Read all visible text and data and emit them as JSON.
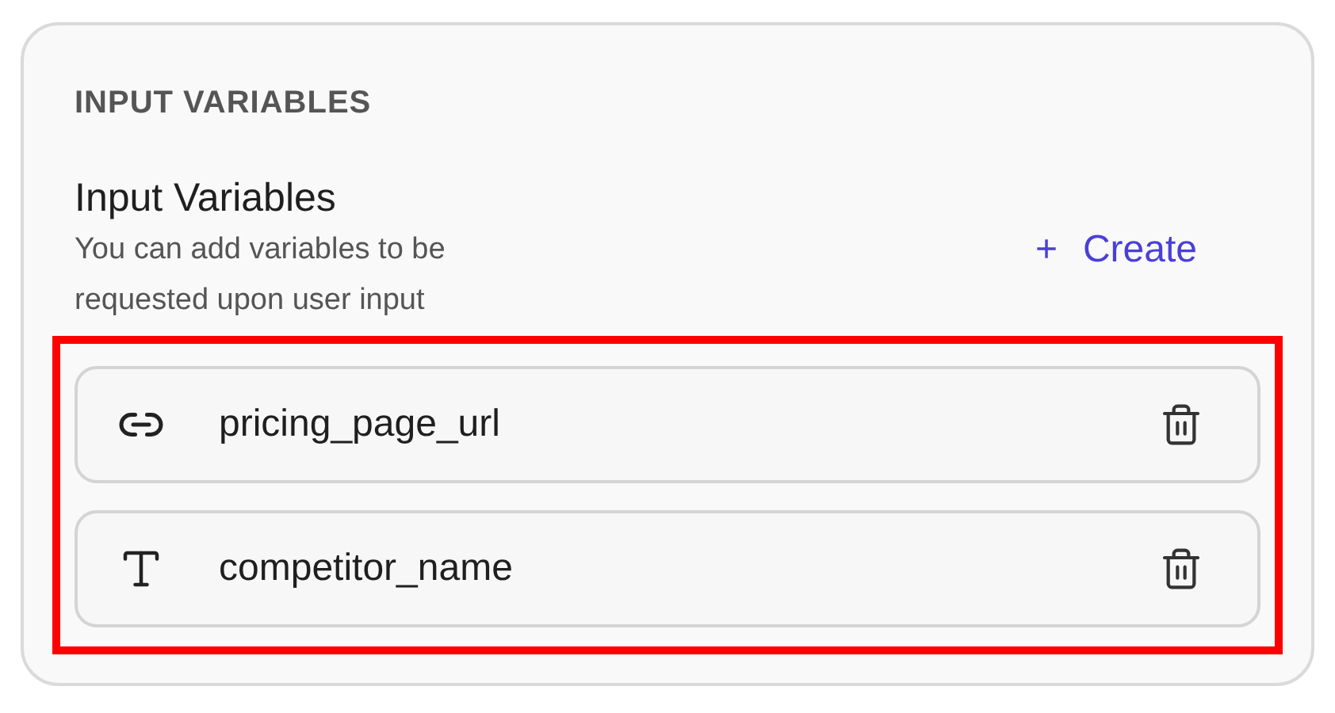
{
  "section_label": "INPUT VARIABLES",
  "header": {
    "title": "Input Variables",
    "description": "You can add variables to be requested upon user input",
    "create_button": {
      "icon": "+",
      "label": "Create"
    }
  },
  "variables_highlighted": true,
  "variables": [
    {
      "kind": "link",
      "name": "pricing_page_url"
    },
    {
      "kind": "text",
      "name": "competitor_name"
    }
  ]
}
